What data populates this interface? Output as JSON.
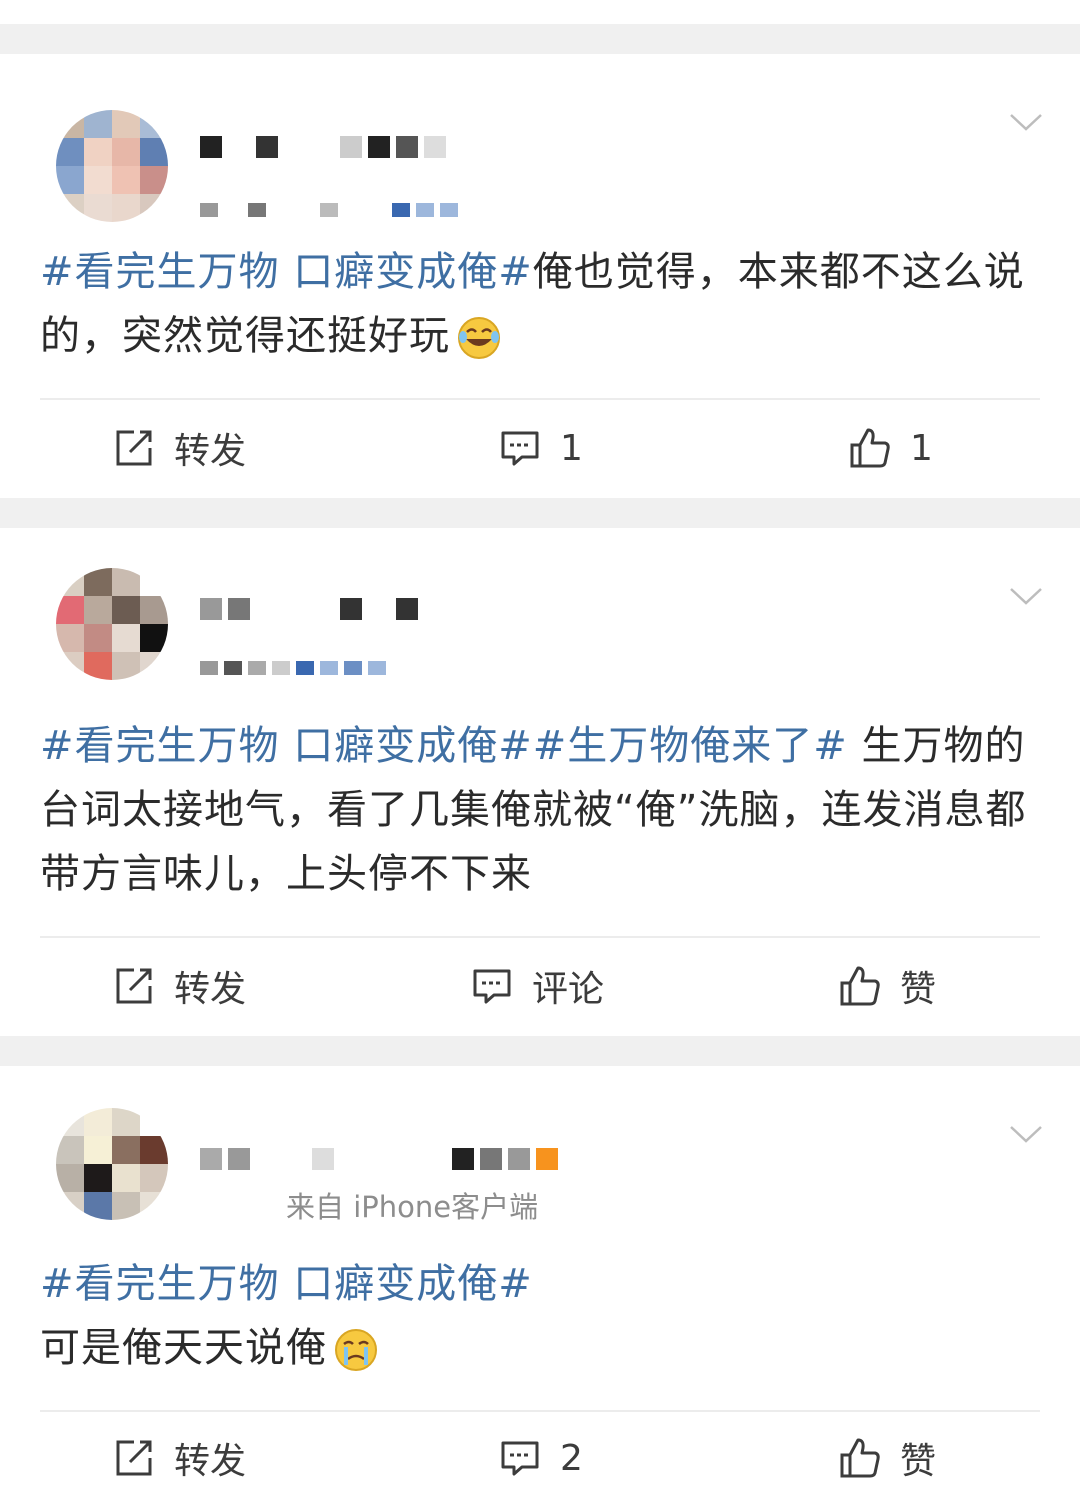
{
  "colors": {
    "hashtag": "#3f6fa3",
    "text": "#2b2b2b",
    "muted": "#8d8d8d",
    "separator": "#f0f0f0"
  },
  "icons": {
    "more": "chevron-down-icon",
    "repost": "share-icon",
    "comment": "comment-icon",
    "like": "thumbs-up-icon"
  },
  "posts": [
    {
      "meta": "",
      "tag_parts": [
        "#看完生万物 口癖变成俺#"
      ],
      "body": "俺也觉得，本来都不这么说的，突然觉得还挺好玩",
      "emoji": "laughing-crying-emoji",
      "actions": {
        "repost": "转发",
        "comment": "1",
        "like": "1"
      }
    },
    {
      "meta": "",
      "tag_parts": [
        "#看完生万物 口癖变成俺#",
        "#生万物俺来了#"
      ],
      "body": " 生万物的台词太接地气，看了几集俺就被“俺”洗脑，连发消息都带方言味儿，上头停不下来",
      "emoji": "",
      "actions": {
        "repost": "转发",
        "comment": "评论",
        "like": "赞"
      }
    },
    {
      "meta": "来自 iPhone客户端",
      "tag_parts": [
        "#看完生万物 口癖变成俺#"
      ],
      "body": "可是俺天天说俺",
      "emoji": "crying-emoji",
      "actions": {
        "repost": "转发",
        "comment": "2",
        "like": "赞"
      }
    }
  ]
}
